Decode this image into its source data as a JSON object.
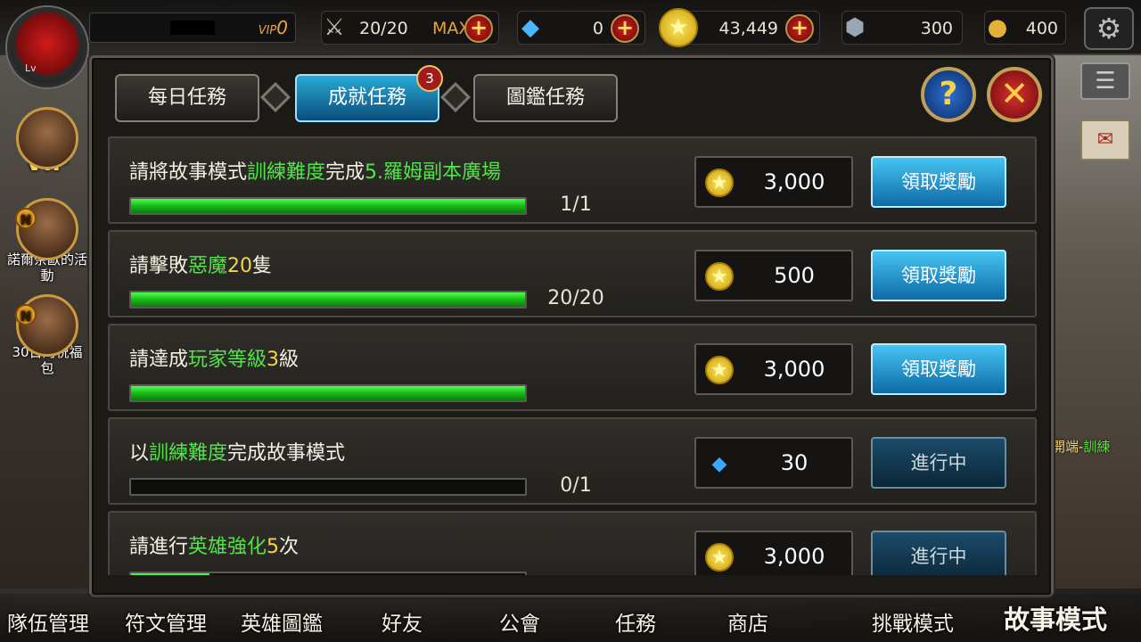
{
  "player": {
    "level_label": "Lv",
    "vip_label": "VIP",
    "vip_value": "0"
  },
  "resources": {
    "stamina": {
      "value": "20/20",
      "max_label": "MAX",
      "icon": "sword-icon"
    },
    "gems": {
      "value": "0",
      "icon": "gem-icon"
    },
    "gold": {
      "value": "43,449",
      "icon": "coin-icon"
    },
    "tokens": {
      "value": "300",
      "icon": "token-icon"
    },
    "cookies": {
      "value": "400",
      "icon": "cookie-icon"
    }
  },
  "left_side": {
    "vip_label": "VIP",
    "events": [
      {
        "badge": "N",
        "label": "諾爾奈歐的活動"
      },
      {
        "badge": "N",
        "label": "30日的祝福包"
      }
    ]
  },
  "right_side": {
    "tag_prefix": "開端-",
    "tag_highlight": "訓練"
  },
  "tabs": [
    {
      "label": "每日任務",
      "active": false
    },
    {
      "label": "成就任務",
      "active": true,
      "badge": "3"
    },
    {
      "label": "圖鑑任務",
      "active": false
    }
  ],
  "quests": [
    {
      "title_parts": [
        {
          "t": "請將故事模式"
        },
        {
          "t": "訓練難度",
          "c": "g"
        },
        {
          "t": "完成"
        },
        {
          "t": "5.羅姆副本廣場",
          "c": "g"
        }
      ],
      "progress_text": "1/1",
      "progress": 1.0,
      "reward_type": "coin",
      "reward_amount": "3,000",
      "action": "領取獎勵",
      "claimable": true
    },
    {
      "title_parts": [
        {
          "t": "請擊敗"
        },
        {
          "t": "惡魔",
          "c": "g"
        },
        {
          "t": "20",
          "c": "y"
        },
        {
          "t": "隻"
        }
      ],
      "progress_text": "20/20",
      "progress": 1.0,
      "reward_type": "coin",
      "reward_amount": "500",
      "action": "領取獎勵",
      "claimable": true
    },
    {
      "title_parts": [
        {
          "t": "請達成"
        },
        {
          "t": "玩家等級",
          "c": "g"
        },
        {
          "t": "3",
          "c": "y"
        },
        {
          "t": "級"
        }
      ],
      "progress_text": "",
      "progress": 1.0,
      "reward_type": "coin",
      "reward_amount": "3,000",
      "action": "領取獎勵",
      "claimable": true
    },
    {
      "title_parts": [
        {
          "t": "以"
        },
        {
          "t": "訓練難度",
          "c": "g"
        },
        {
          "t": "完成故事模式"
        }
      ],
      "progress_text": "0/1",
      "progress": 0.0,
      "reward_type": "gem",
      "reward_amount": "30",
      "action": "進行中",
      "claimable": false
    },
    {
      "title_parts": [
        {
          "t": "請進行"
        },
        {
          "t": "英雄強化",
          "c": "g"
        },
        {
          "t": "5",
          "c": "y"
        },
        {
          "t": "次"
        }
      ],
      "progress_text": "",
      "progress": 0.2,
      "reward_type": "coin",
      "reward_amount": "3,000",
      "action": "進行中",
      "claimable": false
    }
  ],
  "bottom_nav": [
    {
      "label": "隊伍管理"
    },
    {
      "label": "符文管理"
    },
    {
      "label": "英雄圖鑑"
    },
    {
      "label": "好友"
    },
    {
      "label": "公會"
    },
    {
      "label": "任務"
    },
    {
      "label": "商店"
    },
    {
      "label": "挑戰模式"
    },
    {
      "label": "故事模式"
    }
  ],
  "colors": {
    "accent_blue": "#1e8fc4",
    "highlight_green": "#53e34a",
    "highlight_yellow": "#f4d44a",
    "gold": "#e9a23a"
  }
}
